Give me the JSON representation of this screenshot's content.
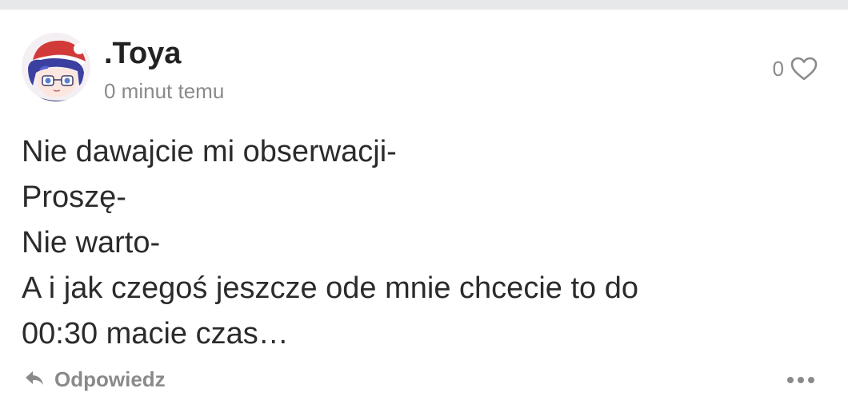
{
  "post": {
    "author": ".Toya",
    "timestamp": "0 minut temu",
    "likes": "0",
    "lines": [
      "Nie dawajcie mi obserwacji-",
      "Proszę-",
      "Nie warto-",
      "A i jak czegoś jeszcze ode mnie chcecie to do",
      "00:30 macie czas…"
    ]
  },
  "actions": {
    "reply_label": "Odpowiedz",
    "reply_icon": "reply-arrow-icon",
    "more_icon": "more-dots-icon",
    "like_icon": "heart-outline-icon"
  },
  "colors": {
    "text": "#2b2b2b",
    "muted": "#8a8a8a",
    "top_strip": "#e6e8ea"
  }
}
